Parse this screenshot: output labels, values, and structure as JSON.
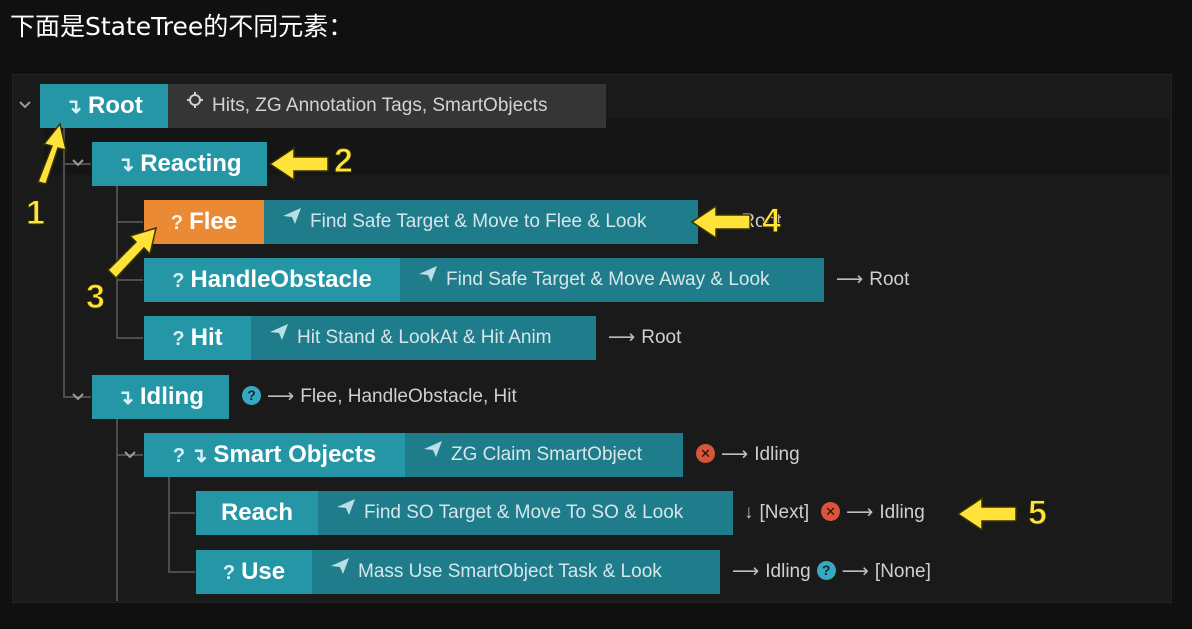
{
  "heading": "下面是StateTree的不同元素：",
  "tree": {
    "root": {
      "label": "Root",
      "tags": "Hits, ZG Annotation Tags, SmartObjects"
    },
    "reacting": {
      "label": "Reacting"
    },
    "flee": {
      "label": "Flee",
      "task": "Find Safe Target & Move to Flee & Look",
      "transition": "Root"
    },
    "handle_obstacle": {
      "label": "HandleObstacle",
      "task": "Find Safe Target & Move Away & Look",
      "transition": "Root"
    },
    "hit": {
      "label": "Hit",
      "task": "Hit Stand & LookAt & Hit Anim",
      "transition": "Root"
    },
    "idling": {
      "label": "Idling",
      "transition": "Flee, HandleObstacle, Hit"
    },
    "smart_objects": {
      "label": "Smart Objects",
      "task": "ZG Claim SmartObject",
      "transition": "Idling"
    },
    "reach": {
      "label": "Reach",
      "task": "Find SO Target & Move To SO & Look",
      "next": "[Next]",
      "transition": "Idling"
    },
    "use": {
      "label": "Use",
      "task": "Mass Use SmartObject Task & Look",
      "transition": "Idling",
      "transition2": "[None]"
    }
  },
  "callouts": [
    "1",
    "2",
    "3",
    "4",
    "5"
  ],
  "colors": {
    "teal": "#2596a6",
    "teal_dark": "#1f7c8b",
    "orange": "#ea8a35",
    "callout_yellow": "#ffe23a"
  }
}
